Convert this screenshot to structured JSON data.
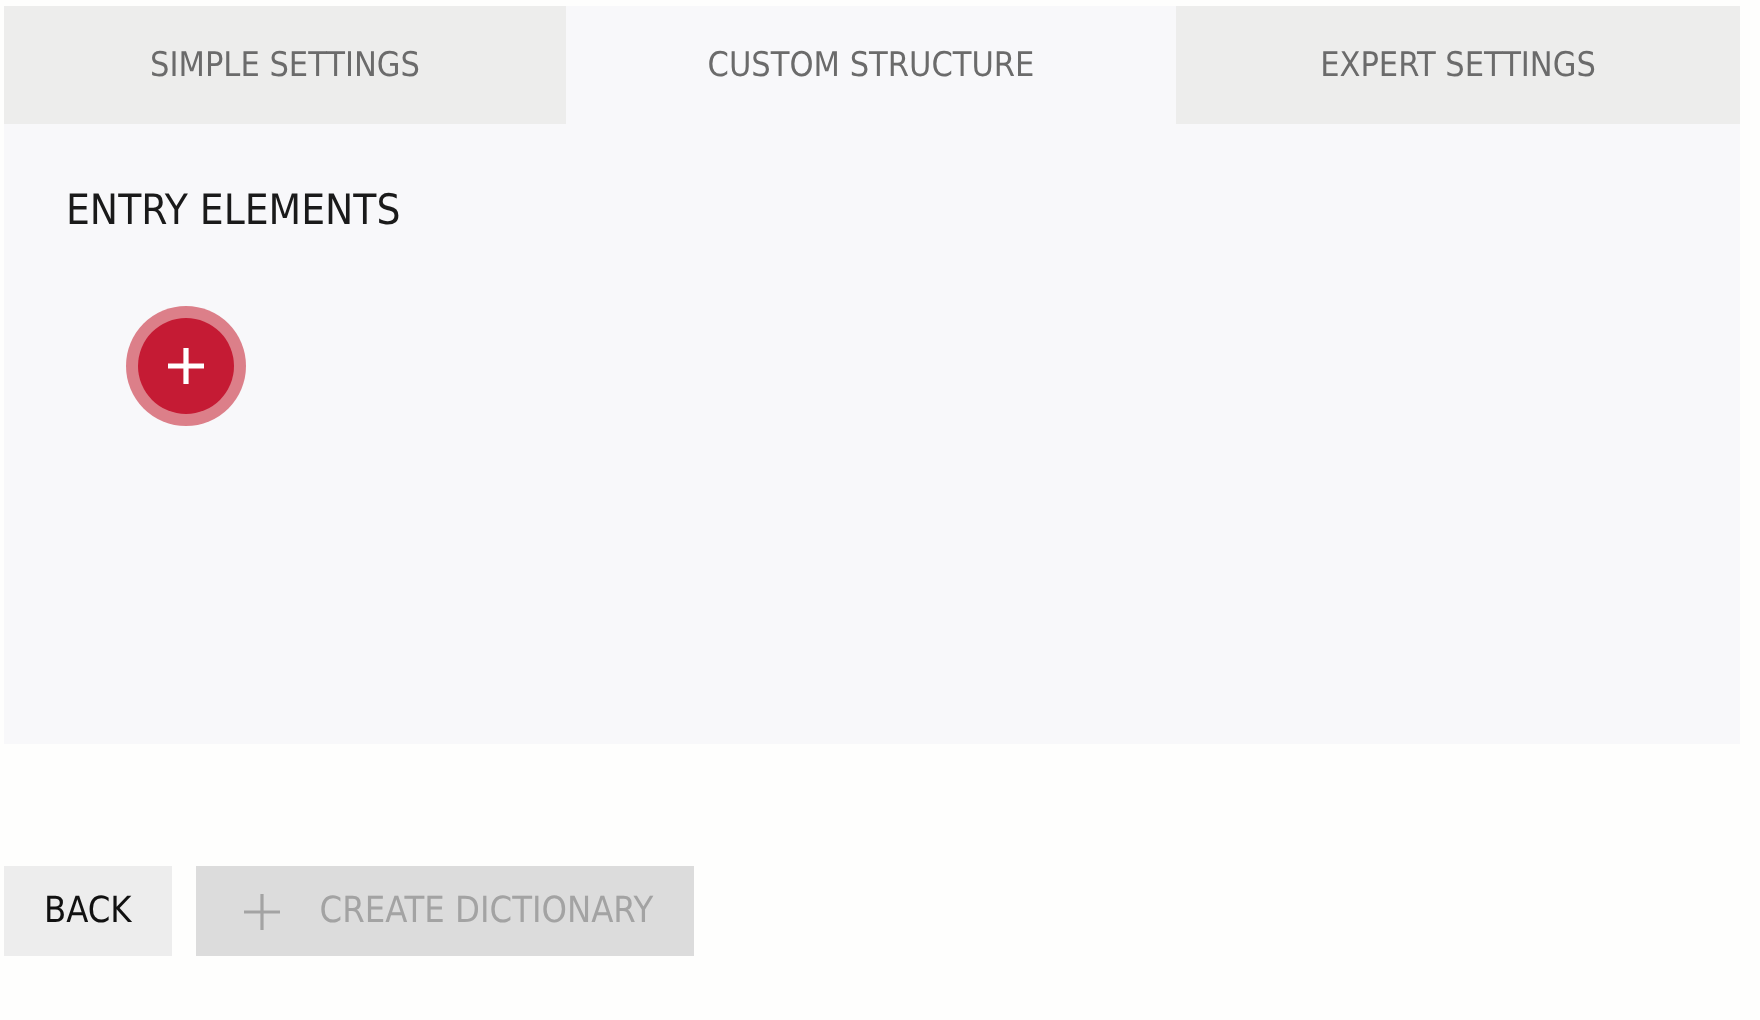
{
  "tabs": [
    {
      "label": "SIMPLE SETTINGS",
      "selected": false
    },
    {
      "label": "CUSTOM STRUCTURE",
      "selected": true
    },
    {
      "label": "EXPERT SETTINGS",
      "selected": false
    }
  ],
  "panel": {
    "heading": "ENTRY ELEMENTS"
  },
  "buttons": [
    {
      "label": "BACK",
      "kind": "plain",
      "disabled": false
    },
    {
      "label": "CREATE DICTIONARY",
      "kind": "add",
      "disabled": true
    }
  ]
}
